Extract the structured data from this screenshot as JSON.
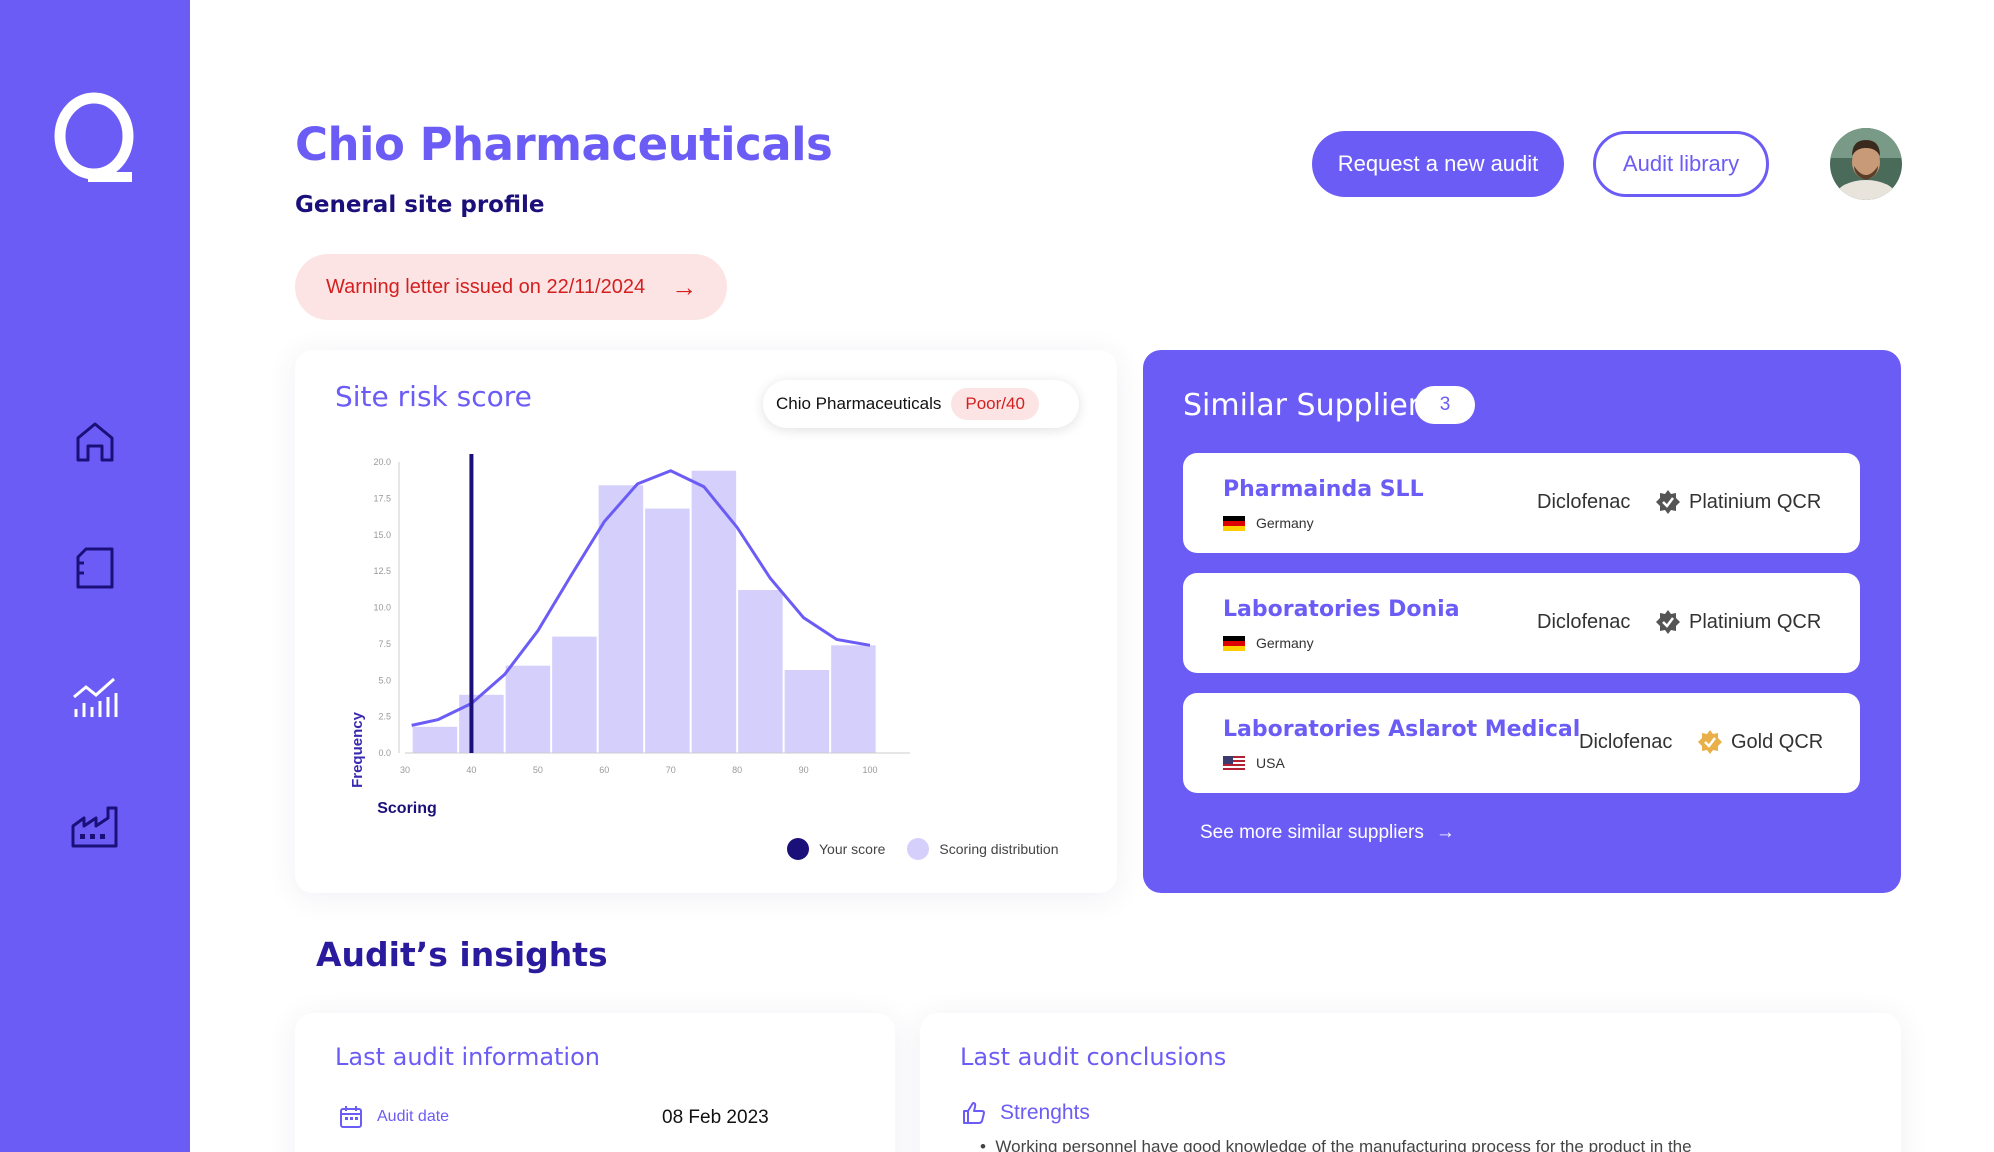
{
  "colors": {
    "accent": "#6c5cf6",
    "navy": "#1b0f7a",
    "warning_bg": "#fde4e4",
    "warning_text": "#d41f1f",
    "dist_fill": "#d5cffb"
  },
  "app": {
    "logo": "Q"
  },
  "sidebar": {
    "items": [
      {
        "icon": "home-icon"
      },
      {
        "icon": "document-icon"
      },
      {
        "icon": "analytics-icon"
      },
      {
        "icon": "factory-icon"
      }
    ]
  },
  "header": {
    "title": "Chio Pharmaceuticals",
    "subtitle": "General site profile",
    "warning": "Warning letter issued on 22/11/2024",
    "request_button": "Request a new audit",
    "library_button": "Audit library"
  },
  "risk": {
    "title": "Site risk score",
    "company": "Chio Pharmaceuticals",
    "badge": "Poor/40",
    "legend_your_score": "Your score",
    "legend_distribution": "Scoring distribution"
  },
  "chart_data": {
    "type": "bar",
    "xlabel": "Scoring",
    "ylabel": "Frequency",
    "x_ticks": [
      "30",
      "40",
      "50",
      "60",
      "70",
      "80",
      "90",
      "100"
    ],
    "y_ticks": [
      "0.0",
      "2.5",
      "5.0",
      "7.5",
      "10.0",
      "12.5",
      "15.0",
      "17.5",
      "20.0"
    ],
    "xlim": [
      30,
      100
    ],
    "ylim": [
      0,
      20
    ],
    "bins": [
      {
        "start": 31,
        "end": 38,
        "value": 1.8
      },
      {
        "start": 38,
        "end": 45,
        "value": 4.0
      },
      {
        "start": 45,
        "end": 52,
        "value": 6.0
      },
      {
        "start": 52,
        "end": 59,
        "value": 8.0
      },
      {
        "start": 59,
        "end": 66,
        "value": 18.4
      },
      {
        "start": 66,
        "end": 73,
        "value": 16.8
      },
      {
        "start": 73,
        "end": 80,
        "value": 19.4
      },
      {
        "start": 80,
        "end": 87,
        "value": 11.2
      },
      {
        "start": 87,
        "end": 94,
        "value": 5.7
      },
      {
        "start": 94,
        "end": 101,
        "value": 7.4
      }
    ],
    "curve": {
      "x": [
        31,
        35,
        40,
        45,
        50,
        55,
        60,
        65,
        70,
        75,
        80,
        85,
        90,
        95,
        100
      ],
      "y": [
        1.9,
        2.3,
        3.4,
        5.4,
        8.4,
        12.2,
        15.9,
        18.5,
        19.4,
        18.3,
        15.5,
        12.0,
        9.3,
        7.8,
        7.4
      ]
    },
    "your_score": 40,
    "grid": false
  },
  "suppliers": {
    "title": "Similar Suppliers",
    "count": "3",
    "see_more": "See more similar suppliers",
    "items": [
      {
        "name": "Pharmainda SLL",
        "country": "Germany",
        "product": "Diclofenac",
        "cert": "Platinium QCR",
        "cert_icon": "platinum-badge-icon"
      },
      {
        "name": "Laboratories Donia",
        "country": "Germany",
        "product": "Diclofenac",
        "cert": "Platinium QCR",
        "cert_icon": "platinum-badge-icon"
      },
      {
        "name": "Laboratories Aslarot Medical",
        "country": "USA",
        "product": "Diclofenac",
        "cert": "Gold QCR",
        "cert_icon": "gold-badge-icon"
      }
    ]
  },
  "insights": {
    "title": "Audit’s insights",
    "last_info": {
      "title": "Last audit information",
      "date_label": "Audit date",
      "date_value": "08 Feb 2023"
    },
    "conclusions": {
      "title": "Last audit conclusions",
      "strengths_label": "Strenghts",
      "bullet": "Working personnel have good knowledge of the manufacturing process for the product in the"
    }
  }
}
